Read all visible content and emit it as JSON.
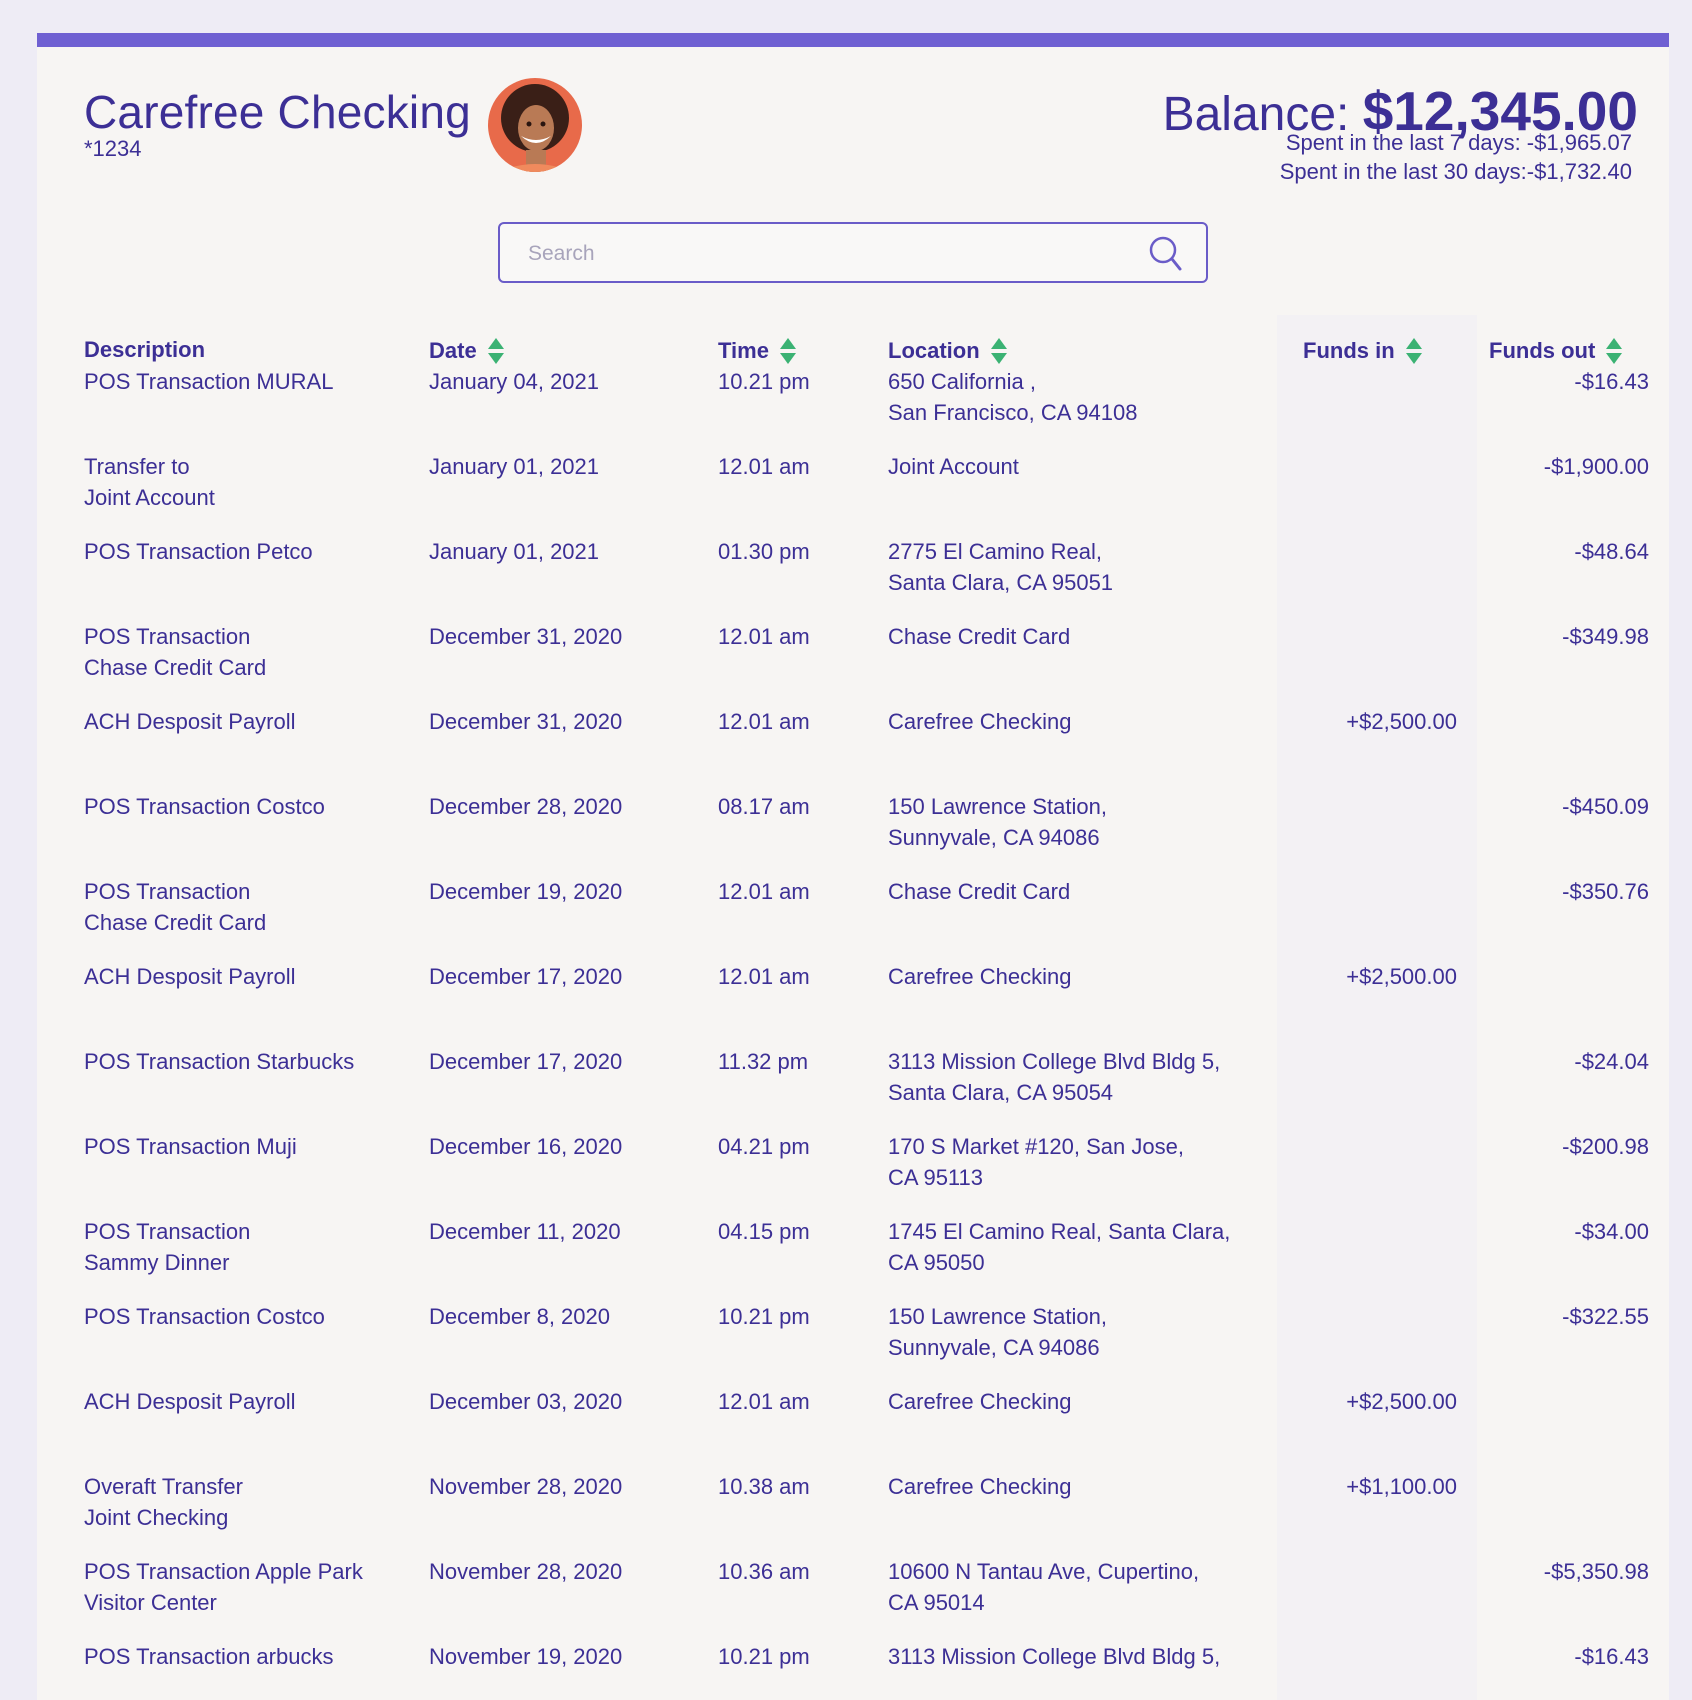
{
  "account": {
    "title": "Carefree Checking",
    "number": "*1234",
    "balance_label": "Balance: ",
    "balance_value": "$12,345.00",
    "spent_7": "Spent in the last 7 days: -$1,965.07",
    "spent_30": "Spent in the last 30 days:-$1,732.40"
  },
  "search": {
    "placeholder": "Search",
    "value": ""
  },
  "columns": {
    "description": "Description",
    "date": "Date",
    "time": "Time",
    "location": "Location",
    "funds_in": "Funds in",
    "funds_out": "Funds out"
  },
  "colors": {
    "accent": "#6f60d2",
    "text": "#3c2f95",
    "sort": "#3bb273",
    "background": "#f7f5f3"
  },
  "transactions": [
    {
      "desc": "POS Transaction MURAL",
      "date": "January 04, 2021",
      "time": "10.21 pm",
      "loc": "650 California ,\nSan Francisco, CA 94108",
      "in": "",
      "out": "-$16.43"
    },
    {
      "desc": "Transfer to\nJoint Account",
      "date": "January 01, 2021",
      "time": "12.01 am",
      "loc": "Joint Account",
      "in": "",
      "out": "-$1,900.00"
    },
    {
      "desc": "POS Transaction Petco",
      "date": "January 01, 2021",
      "time": "01.30 pm",
      "loc": "2775 El Camino Real,\nSanta Clara, CA 95051",
      "in": "",
      "out": "-$48.64"
    },
    {
      "desc": "POS Transaction\nChase Credit Card",
      "date": "December 31, 2020",
      "time": "12.01 am",
      "loc": "Chase Credit Card",
      "in": "",
      "out": "-$349.98"
    },
    {
      "desc": "ACH Desposit Payroll",
      "date": "December 31, 2020",
      "time": "12.01 am",
      "loc": "Carefree Checking",
      "in": "+$2,500.00",
      "out": ""
    },
    {
      "desc": "POS Transaction Costco",
      "date": "December 28, 2020",
      "time": "08.17 am",
      "loc": "150 Lawrence Station,\nSunnyvale, CA 94086",
      "in": "",
      "out": "-$450.09"
    },
    {
      "desc": "POS Transaction\nChase Credit Card",
      "date": "December 19, 2020",
      "time": "12.01 am",
      "loc": "Chase Credit Card",
      "in": "",
      "out": "-$350.76"
    },
    {
      "desc": "ACH Desposit Payroll",
      "date": "December 17, 2020",
      "time": "12.01 am",
      "loc": "Carefree Checking",
      "in": "+$2,500.00",
      "out": ""
    },
    {
      "desc": "POS Transaction Starbucks",
      "date": "December 17, 2020",
      "time": "11.32 pm",
      "loc": "3113 Mission College Blvd Bldg 5,\nSanta Clara, CA 95054",
      "in": "",
      "out": "-$24.04"
    },
    {
      "desc": "POS Transaction Muji",
      "date": "December 16, 2020",
      "time": "04.21 pm",
      "loc": "170 S Market  #120, San Jose,\nCA 95113",
      "in": "",
      "out": "-$200.98"
    },
    {
      "desc": "POS Transaction\nSammy Dinner",
      "date": "December 11, 2020",
      "time": "04.15 pm",
      "loc": "1745 El Camino Real, Santa Clara,\n CA 95050",
      "in": "",
      "out": "-$34.00"
    },
    {
      "desc": "POS Transaction Costco",
      "date": "December 8, 2020",
      "time": "10.21 pm",
      "loc": "150 Lawrence Station,\nSunnyvale, CA 94086",
      "in": "",
      "out": "-$322.55"
    },
    {
      "desc": "ACH Desposit Payroll",
      "date": "December 03, 2020",
      "time": "12.01 am",
      "loc": "Carefree Checking",
      "in": "+$2,500.00",
      "out": ""
    },
    {
      "desc": "Overaft Transfer\nJoint Checking",
      "date": "November 28, 2020",
      "time": "10.38 am",
      "loc": "Carefree Checking",
      "in": "+$1,100.00",
      "out": ""
    },
    {
      "desc": "POS Transaction Apple Park\nVisitor Center",
      "date": "November 28, 2020",
      "time": "10.36 am",
      "loc": "10600 N Tantau Ave, Cupertino,\nCA 95014",
      "in": "",
      "out": "-$5,350.98"
    },
    {
      "desc": "POS Transaction arbucks",
      "date": "November 19, 2020",
      "time": "10.21 pm",
      "loc": "3113 Mission College Blvd Bldg 5,",
      "in": "",
      "out": "-$16.43"
    }
  ]
}
